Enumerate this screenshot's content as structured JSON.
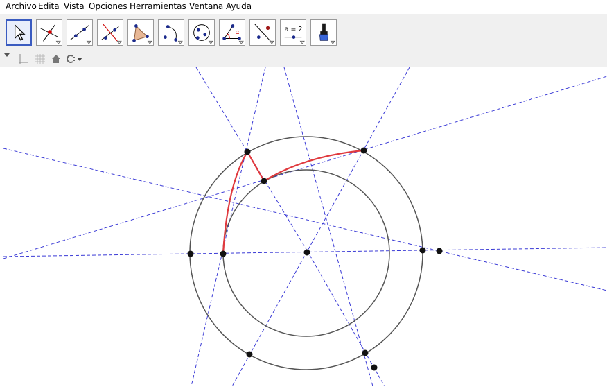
{
  "menu": {
    "archivo": "Archivo",
    "edita": "Edita",
    "vista": "Vista",
    "opciones": "Opciones",
    "herramientas": "Herramientas",
    "ventana": "Ventana",
    "ayuda": "Ayuda"
  },
  "toolbar": {
    "tools": [
      {
        "icon": "move-arrow-icon",
        "selected": true
      },
      {
        "icon": "point-on-intersection-icon"
      },
      {
        "icon": "line-through-points-icon"
      },
      {
        "icon": "perpendicular-line-icon"
      },
      {
        "icon": "polygon-icon"
      },
      {
        "icon": "circle-arc-icon"
      },
      {
        "icon": "circle-with-center-icon"
      },
      {
        "icon": "angle-icon"
      },
      {
        "icon": "reflect-about-line-icon"
      },
      {
        "icon": "slider-icon",
        "label": "a = 2"
      },
      {
        "icon": "style-brush-icon"
      }
    ],
    "angle_symbol": "α"
  },
  "colors": {
    "construction": "#3b3bd6",
    "circle": "#555555",
    "highlight": "#e0393e",
    "point": "#111111"
  }
}
